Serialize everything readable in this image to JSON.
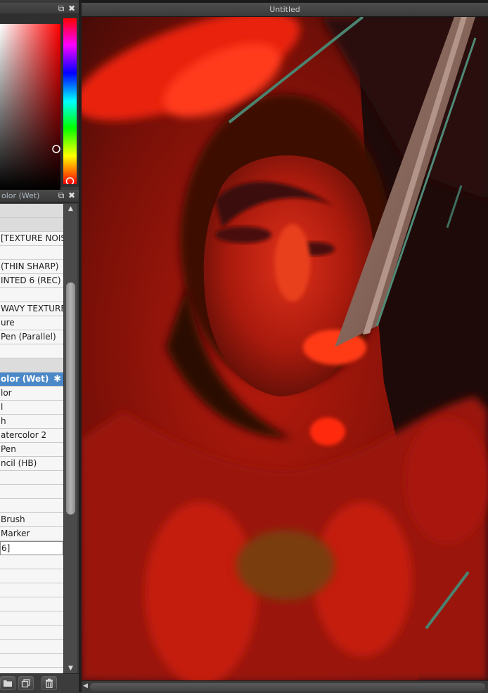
{
  "color_panel": {
    "close_glyph": "✖",
    "popout_glyph": "⧉",
    "selected_color": "#ff2b1a"
  },
  "brush_panel": {
    "title": "olor (Wet)",
    "close_glyph": "✖",
    "popout_glyph": "⧉",
    "items": [
      {
        "label": "",
        "kind": "group"
      },
      {
        "label": "",
        "kind": "group"
      },
      {
        "label": "[TEXTURE NOISE",
        "kind": "item"
      },
      {
        "label": "",
        "kind": "item"
      },
      {
        "label": " (THIN SHARP)",
        "kind": "item"
      },
      {
        "label": "INTED 6 (REC)",
        "kind": "item"
      },
      {
        "label": "",
        "kind": "item"
      },
      {
        "label": "WAVY TEXTURE",
        "kind": "item"
      },
      {
        "label": "ure",
        "kind": "item"
      },
      {
        "label": " Pen (Parallel)",
        "kind": "item"
      },
      {
        "label": "",
        "kind": "item"
      },
      {
        "label": "",
        "kind": "group"
      },
      {
        "label": "olor (Wet)",
        "kind": "selected"
      },
      {
        "label": "lor",
        "kind": "item"
      },
      {
        "label": "l",
        "kind": "item"
      },
      {
        "label": "h",
        "kind": "item"
      },
      {
        "label": "atercolor 2",
        "kind": "item"
      },
      {
        "label": " Pen",
        "kind": "item"
      },
      {
        "label": "ncil (HB)",
        "kind": "item"
      },
      {
        "label": "",
        "kind": "item"
      },
      {
        "label": "",
        "kind": "item"
      },
      {
        "label": "",
        "kind": "item"
      },
      {
        "label": " Brush",
        "kind": "item"
      },
      {
        "label": "Marker",
        "kind": "item"
      },
      {
        "label": "6]",
        "kind": "boxed"
      },
      {
        "label": "",
        "kind": "item"
      },
      {
        "label": "",
        "kind": "item"
      },
      {
        "label": "",
        "kind": "item"
      },
      {
        "label": "",
        "kind": "item"
      },
      {
        "label": "",
        "kind": "item"
      },
      {
        "label": "",
        "kind": "item"
      },
      {
        "label": "",
        "kind": "item"
      },
      {
        "label": "",
        "kind": "item"
      },
      {
        "label": "",
        "kind": "item"
      }
    ],
    "scroll_up": "▲",
    "scroll_down": "▼",
    "gear_glyph": "✱"
  },
  "toolbar": {
    "folder_icon": "folder-icon",
    "duplicate_icon": "duplicate-icon",
    "delete_icon": "trash-icon"
  },
  "canvas": {
    "title": "Untitled",
    "scroll_left": "◀"
  }
}
